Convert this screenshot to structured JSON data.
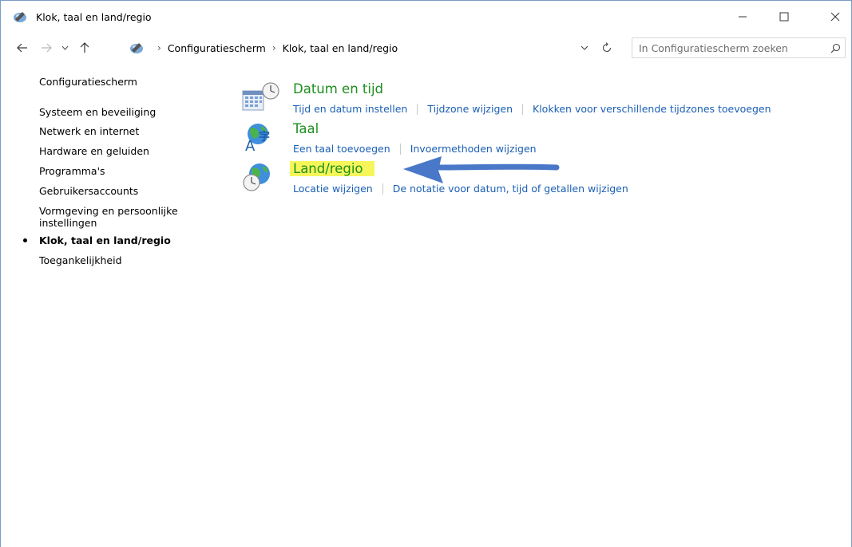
{
  "window": {
    "title": "Klok, taal en land/regio"
  },
  "address_bar": {
    "crumbs": [
      "Configuratiescherm",
      "Klok, taal en land/regio"
    ]
  },
  "search": {
    "placeholder": "In Configuratiescherm zoeken"
  },
  "sidebar": {
    "home": "Configuratiescherm",
    "items": [
      {
        "label": "Systeem en beveiliging"
      },
      {
        "label": "Netwerk en internet"
      },
      {
        "label": "Hardware en geluiden"
      },
      {
        "label": "Programma's"
      },
      {
        "label": "Gebruikersaccounts"
      },
      {
        "label": "Vormgeving en persoonlijke"
      },
      {
        "label": "instellingen"
      },
      {
        "label": "Klok, taal en land/regio"
      },
      {
        "label": "Toegankelijkheid"
      }
    ]
  },
  "categories": [
    {
      "title": "Datum en tijd",
      "icon": "clock-calendar-icon",
      "links": [
        "Tijd en datum instellen",
        "Tijdzone wijzigen",
        "Klokken voor verschillende tijdzones toevoegen"
      ]
    },
    {
      "title": "Taal",
      "icon": "language-globe-icon",
      "links": [
        "Een taal toevoegen",
        "Invoermethoden wijzigen"
      ]
    },
    {
      "title": "Land/regio",
      "icon": "region-globe-clock-icon",
      "links": [
        "Locatie wijzigen",
        "De notatie voor datum, tijd of getallen wijzigen"
      ]
    }
  ],
  "colors": {
    "category_title": "#1e8f1e",
    "link": "#1a5fb4",
    "highlight": "#f6f65a",
    "arrow": "#4a78c8"
  }
}
